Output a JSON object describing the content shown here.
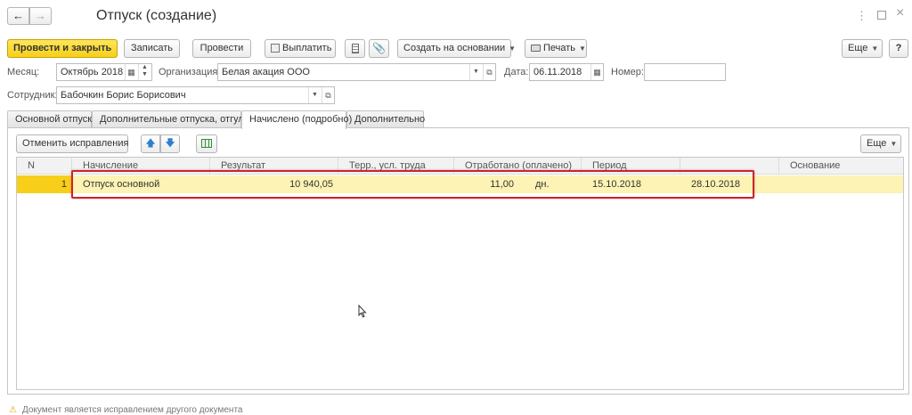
{
  "window": {
    "title": "Отпуск (создание)"
  },
  "toolbar": {
    "post_close": "Провести и закрыть",
    "save": "Записать",
    "post": "Провести",
    "pay": "Выплатить",
    "create_based": "Создать на основании",
    "print": "Печать",
    "more": "Еще",
    "help": "?"
  },
  "header": {
    "month_label": "Месяц:",
    "month_value": "Октябрь 2018",
    "org_label": "Организация:",
    "org_value": "Белая акация ООО",
    "date_label": "Дата:",
    "date_value": "06.11.2018",
    "number_label": "Номер:",
    "number_value": "",
    "employee_label": "Сотрудник:",
    "employee_value": "Бабочкин Борис Борисович"
  },
  "tabs": [
    {
      "label": "Основной отпуск"
    },
    {
      "label": "Дополнительные отпуска, отгулы"
    },
    {
      "label": "Начислено (подробно)"
    },
    {
      "label": "Дополнительно"
    }
  ],
  "table_toolbar": {
    "cancel_corrections": "Отменить исправления",
    "more": "Еще"
  },
  "table": {
    "columns": [
      "N",
      "Начисление",
      "Результат",
      "Терр., усл. труда",
      "Отработано (оплачено)",
      "Период",
      "",
      "Основание"
    ],
    "rows": [
      {
        "n": "1",
        "accrual": "Отпуск основной",
        "result": "10 940,05",
        "territory": "",
        "worked": "11,00",
        "unit": "дн.",
        "period_start": "15.10.2018",
        "period_end": "28.10.2018",
        "basis": ""
      }
    ]
  },
  "footer": {
    "warning": "Документ является исправлением другого документа"
  },
  "colors": {
    "accent": "#f7cf1a",
    "selected_row": "#fcf3b4",
    "highlight": "#c6262e"
  }
}
